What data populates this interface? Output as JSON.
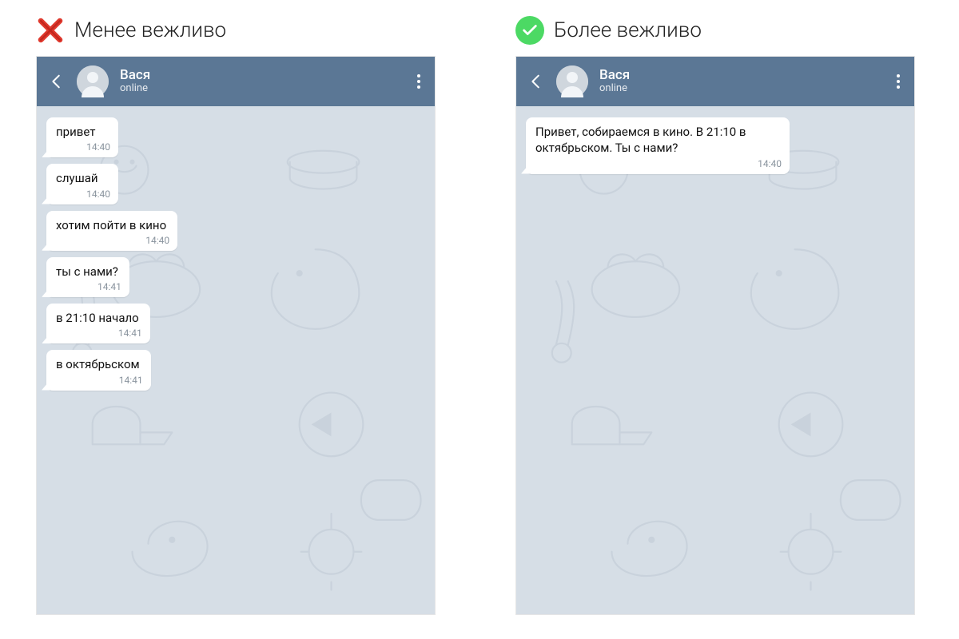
{
  "colors": {
    "header_bg": "#5b7795",
    "chat_bg": "#d6dee6",
    "check_bg": "#4cd964",
    "cross_fg": "#e03a2f"
  },
  "left": {
    "heading": "Менее вежливо",
    "mark": "cross",
    "chat": {
      "name": "Вася",
      "status": "online",
      "messages": [
        {
          "text": "привет",
          "time": "14:40"
        },
        {
          "text": "слушай",
          "time": "14:40"
        },
        {
          "text": "хотим пойти в кино",
          "time": "14:40"
        },
        {
          "text": "ты с нами?",
          "time": "14:41"
        },
        {
          "text": "в 21:10 начало",
          "time": "14:41"
        },
        {
          "text": "в октябрьском",
          "time": "14:41"
        }
      ]
    }
  },
  "right": {
    "heading": "Более вежливо",
    "mark": "check",
    "chat": {
      "name": "Вася",
      "status": "online",
      "messages": [
        {
          "text": "Привет, собираемся в кино. В 21:10 в октябрьском. Ты с нами?",
          "time": "14:40"
        }
      ]
    }
  }
}
